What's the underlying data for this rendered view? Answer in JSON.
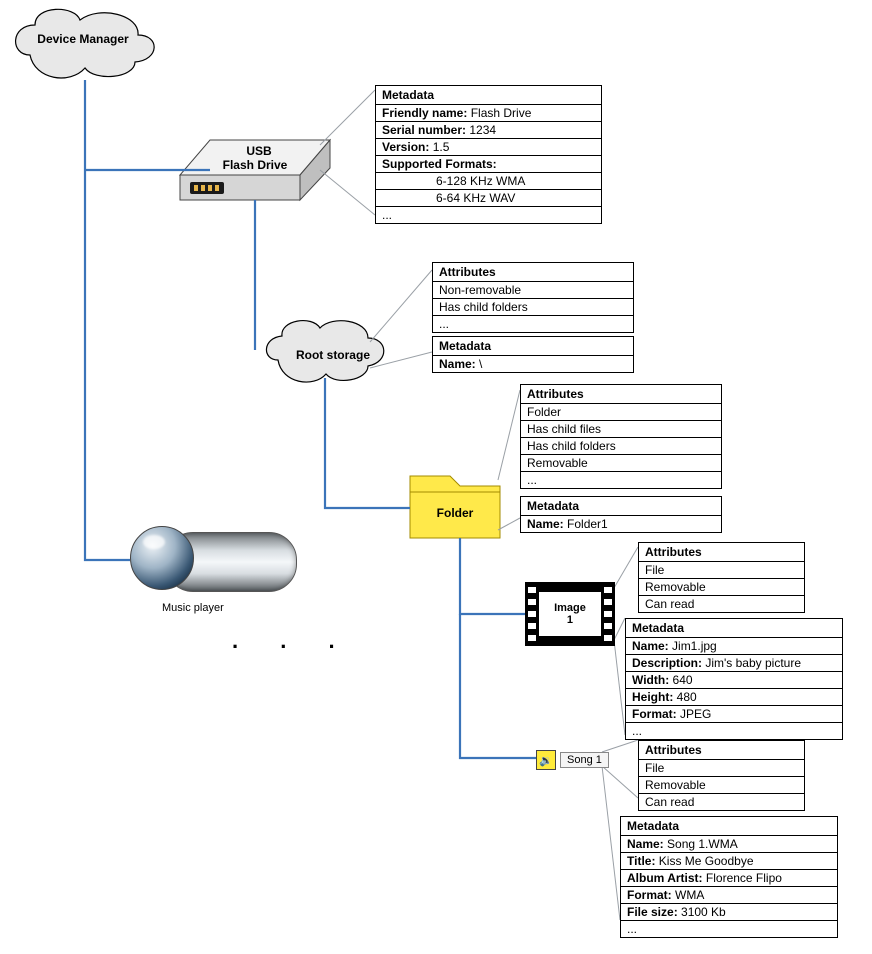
{
  "deviceManager": {
    "label": "Device Manager"
  },
  "usb": {
    "line1": "USB",
    "line2": "Flash Drive",
    "metaHeader": "Metadata",
    "friendly_k": "Friendly name:",
    "friendly_v": " Flash Drive",
    "serial_k": "Serial number:",
    "serial_v": " 1234",
    "version_k": "Version:",
    "version_v": " 1.5",
    "formats_k": "Supported Formats:",
    "fmt1": "6-128 KHz WMA",
    "fmt2": "6-64 KHz WAV",
    "ellipsis": "..."
  },
  "root": {
    "label": "Root storage",
    "attrHeader": "Attributes",
    "attr1": "Non-removable",
    "attr2": "Has child folders",
    "attrEllipsis": "...",
    "metaHeader": "Metadata",
    "name_k": "Name:",
    "name_v": " \\"
  },
  "folder": {
    "label": "Folder",
    "attrHeader": "Attributes",
    "a1": "Folder",
    "a2": "Has child files",
    "a3": "Has child folders",
    "a4": "Removable",
    "ae": "...",
    "metaHeader": "Metadata",
    "name_k": "Name:",
    "name_v": " Folder1"
  },
  "image": {
    "line1": "Image",
    "line2": "1",
    "attrHeader": "Attributes",
    "a1": "File",
    "a2": "Removable",
    "a3": "Can read",
    "metaHeader": "Metadata",
    "name_k": "Name:",
    "name_v": " Jim1.jpg",
    "desc_k": "Description:",
    "desc_v": " Jim's baby picture",
    "width_k": "Width:",
    "width_v": " 640",
    "height_k": "Height:",
    "height_v": " 480",
    "format_k": "Format:",
    "format_v": " JPEG",
    "ellipsis": "..."
  },
  "song": {
    "label": "Song 1",
    "attrHeader": "Attributes",
    "a1": "File",
    "a2": "Removable",
    "a3": "Can read",
    "metaHeader": "Metadata",
    "name_k": "Name:",
    "name_v": " Song 1.WMA",
    "title_k": "Title:",
    "title_v": " Kiss Me Goodbye",
    "artist_k": "Album Artist:",
    "artist_v": " Florence Flipo",
    "format_k": "Format:",
    "format_v": " WMA",
    "size_k": "File size:",
    "size_v": " 3100 Kb",
    "ellipsis": "..."
  },
  "musicPlayer": {
    "label": "Music player"
  },
  "dots": ".  .  ."
}
